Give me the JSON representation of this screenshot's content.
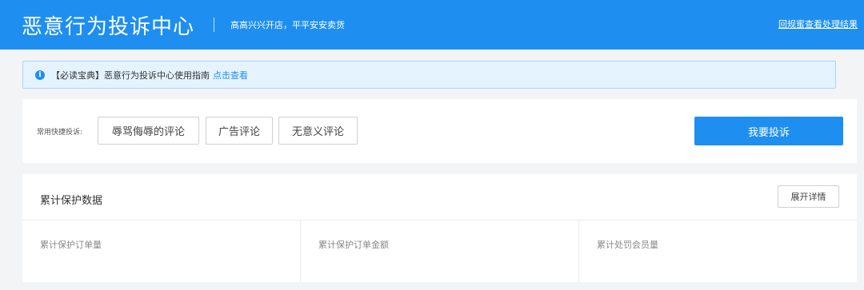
{
  "header": {
    "title": "恶意行为投诉中心",
    "slogan": "高高兴兴开店，平平安安卖货",
    "result_link": "回规蜜查看处理结果"
  },
  "notice": {
    "icon": "info-icon",
    "text": "【必读宝典】恶意行为投诉中心使用指南",
    "link": "点击查看"
  },
  "quick_complaint": {
    "label": "常用快捷投诉:",
    "tags": [
      "辱骂侮辱的评论",
      "广告评论",
      "无意义评论"
    ],
    "complain_button": "我要投诉"
  },
  "stats": {
    "title": "累计保护数据",
    "expand_button": "展开详情",
    "metrics": [
      "累计保护订单量",
      "累计保护订单金额",
      "累计处罚会员量"
    ]
  },
  "colors": {
    "primary": "#1e8ff0",
    "notice_bg": "#e5f3ff",
    "page_bg": "#f3f4f6"
  }
}
